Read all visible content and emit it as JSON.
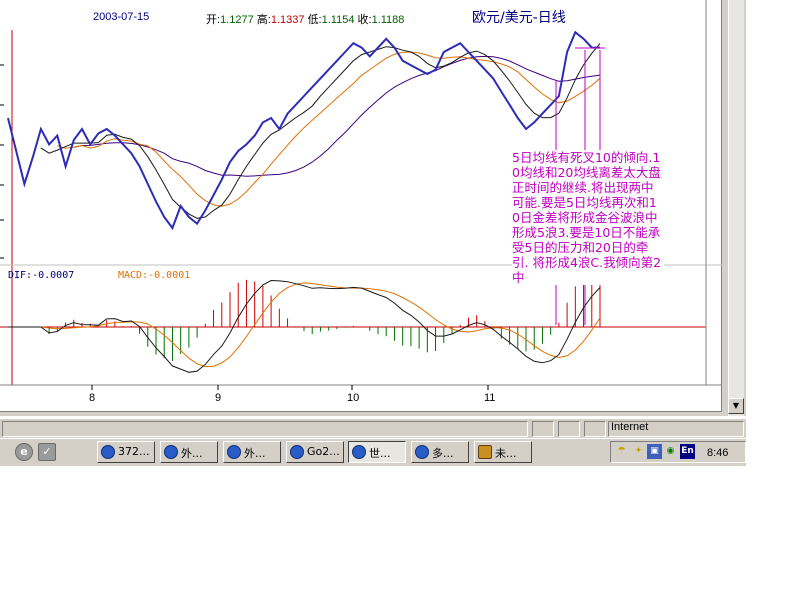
{
  "chart": {
    "title": "欧元/美元-日线",
    "date": "2003-07-15",
    "ohlc": {
      "open_label": "开:",
      "open": "1.1277",
      "high_label": "高:",
      "high": "1.1337",
      "low_label": "低:",
      "low": "1.1154",
      "close_label": "收:",
      "close": "1.1188"
    },
    "x_ticks": [
      "8",
      "9",
      "10",
      "11"
    ],
    "annotation": "5日均线有死叉10的倾向.10均线和20均线离差太大盘正时间的继续.将出现两中可能.要是5日均线再次和10日金差将形成金谷波浪中形成5浪3.要是10日不能承受5日的压力和20日的牵引. 将形成4浪C.我倾向第2中",
    "colors": {
      "price": "#2c2cb8",
      "ma5": "#1a1a1a",
      "ma10": "#e07000",
      "ma20": "#400080",
      "annotation": "#c000c0",
      "macd_positive": "#d00000",
      "macd_negative": "#007000"
    }
  },
  "chart_data": {
    "type": "line",
    "price": [
      60,
      45,
      30,
      42,
      55,
      48,
      52,
      38,
      50,
      55,
      48,
      53,
      55,
      52,
      48,
      44,
      38,
      30,
      22,
      15,
      10,
      20,
      15,
      12,
      18,
      25,
      32,
      40,
      45,
      48,
      52,
      58,
      60,
      55,
      62,
      66,
      70,
      74,
      78,
      82,
      86,
      90,
      94,
      92,
      88,
      92,
      96,
      92,
      86,
      84,
      82,
      80,
      82,
      90,
      92,
      94,
      90,
      86,
      82,
      78,
      72,
      66,
      60,
      55,
      58,
      62,
      66,
      70,
      90,
      99,
      96,
      92,
      92
    ],
    "ma5_label": "",
    "macd": {
      "dif": "-0.0007",
      "macd": "-0.0001",
      "dif_label": "DIF:",
      "macd_label": "MACD:"
    }
  },
  "status": {
    "zone": "Internet"
  },
  "taskbar": {
    "quick_launch": [
      "ie-icon",
      "desktop-icon"
    ],
    "buttons": [
      {
        "label": "372...",
        "icon": "ie-icon"
      },
      {
        "label": "外...",
        "icon": "ie-icon"
      },
      {
        "label": "外...",
        "icon": "ie-icon"
      },
      {
        "label": "Go2...",
        "icon": "ie-icon"
      },
      {
        "label": "世...",
        "icon": "ie-icon",
        "active": true
      },
      {
        "label": "多...",
        "icon": "ie-icon"
      },
      {
        "label": "未...",
        "icon": "paint-icon"
      }
    ],
    "tray_lang": "En",
    "clock": "8:46"
  }
}
